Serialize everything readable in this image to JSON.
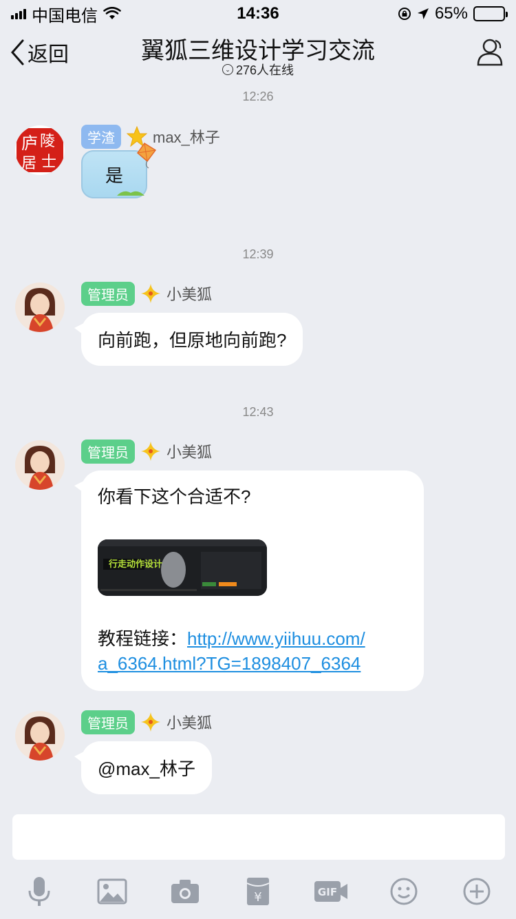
{
  "status": {
    "carrier": "中国电信",
    "time": "14:36",
    "battery": "65%",
    "battery_level": 0.65
  },
  "nav": {
    "back_label": "返回",
    "title": "翼狐三维设计学习交流",
    "subtitle": "276人在线"
  },
  "messages": {
    "t1": "12:26",
    "m1": {
      "badge": "学渣",
      "name": "max_林子",
      "text": "是"
    },
    "t2": "12:39",
    "m2": {
      "badge": "管理员",
      "name": "小美狐",
      "text": "向前跑，但原地向前跑?"
    },
    "t3": "12:43",
    "m3": {
      "badge": "管理员",
      "name": "小美狐",
      "text": "你看下这个合适不?",
      "link_prefix": "教程链接：",
      "link_line1": "http://www.yiihuu.com/",
      "link_line2": "a_6364.html?TG=1898407_6364",
      "thumb_title": "行走动作设计"
    },
    "m4": {
      "badge": "管理员",
      "name": "小美狐",
      "text": "@max_林子"
    }
  },
  "toolbar": [
    "mic-icon",
    "image-icon",
    "camera-icon",
    "red-packet-icon",
    "gif-icon",
    "emoji-icon",
    "plus-icon"
  ]
}
